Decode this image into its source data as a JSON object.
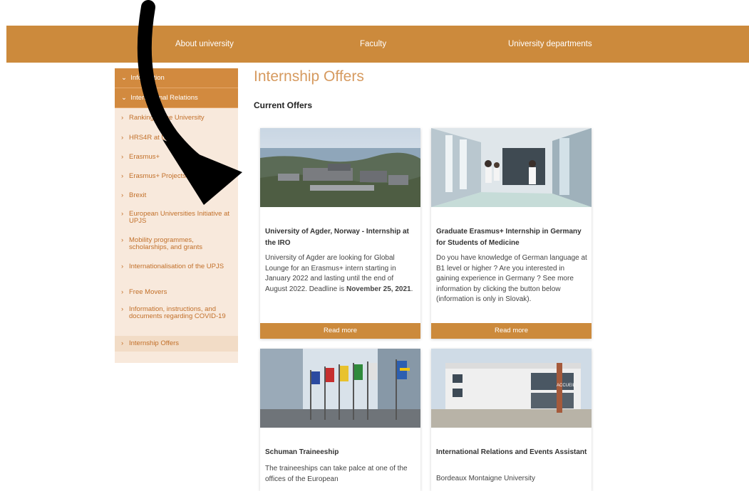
{
  "nav": {
    "items": [
      "About university",
      "Faculty",
      "University departments"
    ]
  },
  "sidebar": {
    "heads": [
      "Information",
      "International Relations"
    ],
    "items": [
      "Ranking of the University",
      "HRS4R at UPJS",
      "Erasmus+",
      "Erasmus+ Projects",
      "Brexit",
      "European Universities Initiative at UPJS",
      "Mobility programmes, scholarships, and grants",
      "Internationalisation of the UPJS",
      "Free Movers",
      "Information, instructions, and documents regarding COVID-19",
      "Internship Offers"
    ],
    "active_item": "Internship Offers"
  },
  "page": {
    "title": "Internship Offers",
    "subtitle": "Current Offers"
  },
  "cards": [
    {
      "title": "University of Agder, Norway - Internship at the IRO",
      "desc": "University of Agder are looking for Global Lounge for an Erasmus+ intern starting in January 2022 and lasting until the end of August 2022. Deadline is ",
      "desc_bold": "November 25, 2021",
      "desc_end": ".",
      "button": "Read more"
    },
    {
      "title": "Graduate Erasmus+ Internship in Germany for Students of Medicine",
      "desc": "Do you have knowledge of German language at B1 level or higher ? Are you interested in gaining experience in Germany ? See more information by clicking the button below (information is only in Slovak).",
      "button": "Read more"
    },
    {
      "title": "Schuman Traineeship",
      "desc": "The traineeships can take palce at one of the offices of the European"
    },
    {
      "title": "International Relations and Events Assistant",
      "desc": "Bordeaux Montaigne University",
      "image_sign": "ACCUEIL"
    }
  ],
  "colors": {
    "brand": "#cc8a3c",
    "sidebar_bg": "#f8e9dc",
    "sidebar_text": "#c2702a",
    "title": "#d69a5f"
  },
  "icons": {
    "nav_expand": "chevron-down-icon",
    "sidebar_item": "chevron-right-icon",
    "overlay": "curved-arrow-icon"
  }
}
